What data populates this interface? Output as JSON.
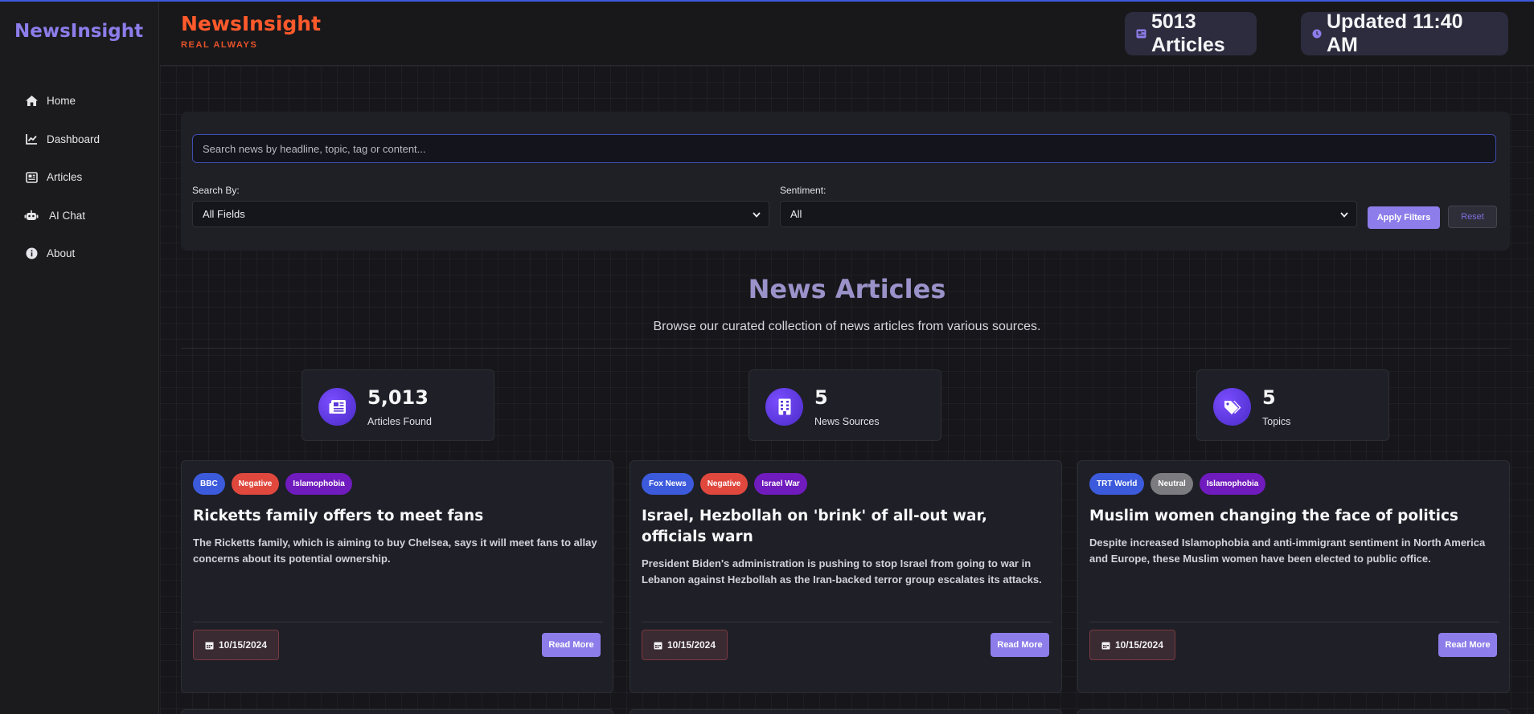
{
  "sidebar": {
    "brand": "NewsInsight",
    "items": [
      {
        "label": "Home",
        "icon": "home-icon"
      },
      {
        "label": "Dashboard",
        "icon": "chart-line-icon"
      },
      {
        "label": "Articles",
        "icon": "newspaper-icon"
      },
      {
        "label": "AI Chat",
        "icon": "robot-icon"
      },
      {
        "label": "About",
        "icon": "info-icon"
      }
    ]
  },
  "header": {
    "title": "NewsInsight",
    "subtitle": "REAL ALWAYS",
    "articles_badge": "5013 Articles",
    "updated_badge": "Updated 11:40 AM"
  },
  "filters": {
    "search_placeholder": "Search news by headline, topic, tag or content...",
    "search_by_label": "Search By:",
    "search_by_value": "All Fields",
    "sentiment_label": "Sentiment:",
    "sentiment_value": "All",
    "apply_label": "Apply Filters",
    "reset_label": "Reset"
  },
  "section": {
    "title": "News Articles",
    "subtitle": "Browse our curated collection of news articles from various sources."
  },
  "stats": [
    {
      "value": "5,013",
      "label": "Articles Found",
      "icon": "newspaper-icon"
    },
    {
      "value": "5",
      "label": "News Sources",
      "icon": "building-icon"
    },
    {
      "value": "5",
      "label": "Topics",
      "icon": "tags-icon"
    }
  ],
  "articles": [
    {
      "source": "BBC",
      "sentiment": "Negative",
      "topic": "Islamophobia",
      "title": "Ricketts family offers to meet fans",
      "summary": "The Ricketts family, which is aiming to buy Chelsea, says it will meet fans to allay concerns about its potential ownership.",
      "date": "10/15/2024",
      "read_more": "Read More"
    },
    {
      "source": "Fox News",
      "sentiment": "Negative",
      "topic": "Israel War",
      "title": "Israel, Hezbollah on 'brink' of all-out war, officials warn",
      "summary": "President Biden's administration is pushing to stop Israel from going to war in Lebanon against Hezbollah as the Iran-backed terror group escalates its attacks.",
      "date": "10/15/2024",
      "read_more": "Read More"
    },
    {
      "source": "TRT World",
      "sentiment": "Neutral",
      "topic": "Islamophobia",
      "title": "Muslim women changing the face of politics",
      "summary": "Despite increased Islamophobia and anti-immigrant sentiment in North America and Europe, these Muslim women have been elected to public office.",
      "date": "10/15/2024",
      "read_more": "Read More"
    }
  ],
  "colors": {
    "accent": "#8c7dea",
    "brand_orange": "#ff5a2b",
    "negative": "#e0483e",
    "neutral": "#7b7b80",
    "source": "#3c5bdc",
    "topic": "#6f1bbd"
  }
}
